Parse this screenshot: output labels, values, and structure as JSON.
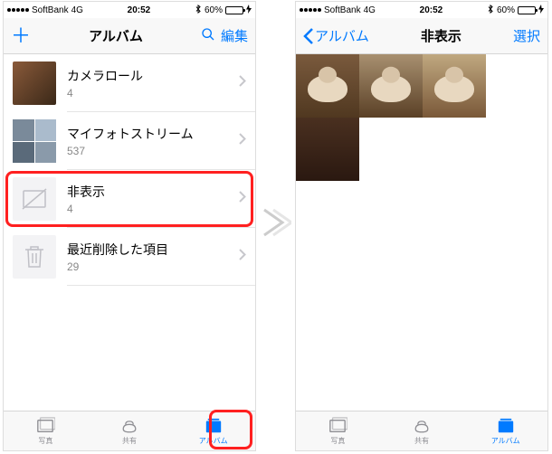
{
  "status": {
    "carrier": "SoftBank",
    "network": "4G",
    "time": "20:52",
    "battery_pct": "60%",
    "battery_fill": "60%"
  },
  "left": {
    "nav": {
      "title": "アルバム",
      "edit": "編集"
    },
    "albums": [
      {
        "name": "カメラロール",
        "count": "4"
      },
      {
        "name": "マイフォトストリーム",
        "count": "537"
      },
      {
        "name": "非表示",
        "count": "4"
      },
      {
        "name": "最近削除した項目",
        "count": "29"
      }
    ]
  },
  "right": {
    "nav": {
      "back": "アルバム",
      "title": "非表示",
      "select": "選択"
    }
  },
  "tabs": {
    "photos": "写真",
    "shared": "共有",
    "albums": "アルバム"
  }
}
